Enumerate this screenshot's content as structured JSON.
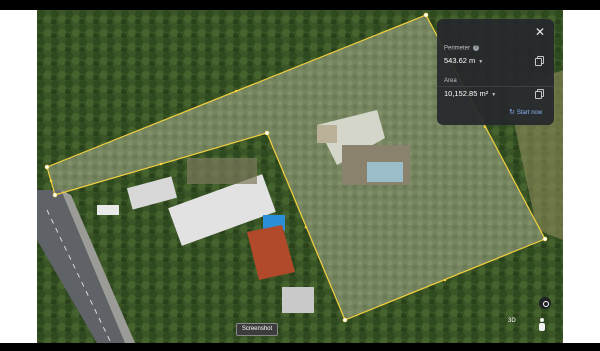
{
  "measure_panel": {
    "perimeter_label": "Perimeter",
    "perimeter_value": "543.62 m",
    "area_label": "Area",
    "area_value": "10,152.85 m²",
    "start_now_label": "Start now",
    "close_icon": "close-icon",
    "info_icon": "info-icon"
  },
  "tooltip": {
    "label": "Screenshot"
  },
  "controls": {
    "label_3d": "3D",
    "compass_icon": "compass-icon",
    "pegman_icon": "pegman-icon"
  },
  "colors": {
    "outline": "#f4d03f",
    "panel_bg": "#26282c",
    "link": "#8ab4f8"
  }
}
